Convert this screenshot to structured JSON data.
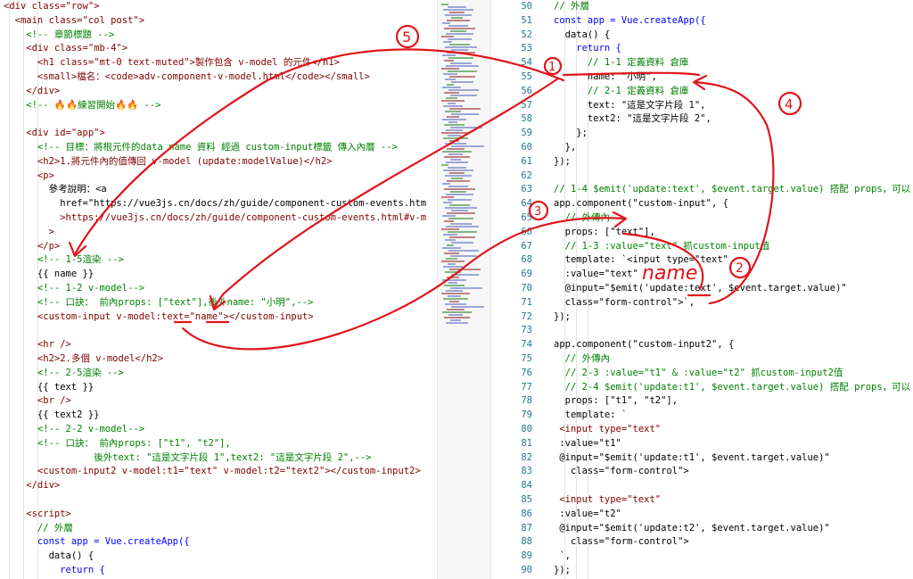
{
  "colors": {
    "tag": "#800000",
    "attr": "#e50000",
    "value": "#0000ff",
    "comment": "#008000",
    "keyword": "#0000ff",
    "text": "#000000",
    "string": "#a31515",
    "line_number": "#237893",
    "annotation": "#e0141b"
  },
  "left_pane": {
    "lines": [
      "<div class=\"row\">",
      "  <main class=\"col post\">",
      "    <!-- 章節標題 -->",
      "    <div class=\"mb-4\">",
      "      <h1 class=\"mt-0 text-muted\">製作包含 v-model 的元件</h1>",
      "      <small>檔名：<code>adv-component-v-model.html</code></small>",
      "    </div>",
      "    <!-- 🔥🔥練習開始🔥🔥 -->",
      "",
      "    <div id=\"app\">",
      "      <!-- 目標：將根元件的data name 資料 經過 custom-input標籤 傳入內層 -->",
      "      <h2>1.將元件內的值傳回 v-model (update:modelValue)</h2>",
      "      <p>",
      "        參考說明：<a",
      "          href=\"https://vue3js.cn/docs/zh/guide/component-custom-events.htm",
      "          >https://vue3js.cn/docs/zh/guide/component-custom-events.html#v-m",
      "        >",
      "      </p>",
      "      <!-- 1-5渲染 -->",
      "      {{ name }}",
      "      <!-- 1-2 v-model-->",
      "      <!-- 口訣： 前內props: [\"text\"],後外name: \"小明\",-->",
      "      <custom-input v-model:text=\"name\"></custom-input>",
      "",
      "      <hr />",
      "      <h2>2.多個 v-model</h2>",
      "      <!-- 2-5渲染 -->",
      "      {{ text }}",
      "      <br />",
      "      {{ text2 }}",
      "      <!-- 2-2 v-model-->",
      "      <!-- 口訣： 前內props: [\"t1\", \"t2\"],",
      "                後外text: \"這是文字片段 1\",text2: \"這是文字片段 2\",-->",
      "      <custom-input2 v-model:t1=\"text\" v-model:t2=\"text2\"></custom-input2>",
      "    </div>",
      "",
      "    <script>",
      "      // 外層",
      "      const app = Vue.createApp({",
      "        data() {",
      "          return {"
    ]
  },
  "right_pane": {
    "lines": [
      {
        "num": "50",
        "text": "// 外層"
      },
      {
        "num": "51",
        "text": "const app = Vue.createApp({"
      },
      {
        "num": "52",
        "text": "  data() {"
      },
      {
        "num": "53",
        "text": "    return {"
      },
      {
        "num": "54",
        "text": "      // 1-1 定義資料 倉庫"
      },
      {
        "num": "55",
        "text": "      name: \"小明\","
      },
      {
        "num": "56",
        "text": "      // 2-1 定義資料 倉庫"
      },
      {
        "num": "57",
        "text": "      text: \"這是文字片段 1\","
      },
      {
        "num": "58",
        "text": "      text2: \"這是文字片段 2\","
      },
      {
        "num": "59",
        "text": "    };"
      },
      {
        "num": "60",
        "text": "  },"
      },
      {
        "num": "61",
        "text": "});"
      },
      {
        "num": "62",
        "text": ""
      },
      {
        "num": "63",
        "text": "// 1-4 $emit('update:text', $event.target.value) 搭配 props，可以"
      },
      {
        "num": "64",
        "text": "app.component(\"custom-input\", {"
      },
      {
        "num": "65",
        "text": "  // 外傳內"
      },
      {
        "num": "66",
        "text": "  props: [\"text\"],"
      },
      {
        "num": "67",
        "text": "  // 1-3 :value=\"text\" 抓custom-input值"
      },
      {
        "num": "68",
        "text": "  template: `<input type=\"text\""
      },
      {
        "num": "69",
        "text": "  :value=\"text\""
      },
      {
        "num": "70",
        "text": "  @input=\"$emit('update:text', $event.target.value)\""
      },
      {
        "num": "71",
        "text": "  class=\"form-control\">`,"
      },
      {
        "num": "72",
        "text": "});"
      },
      {
        "num": "73",
        "text": ""
      },
      {
        "num": "74",
        "text": "app.component(\"custom-input2\", {"
      },
      {
        "num": "75",
        "text": "  // 外傳內"
      },
      {
        "num": "76",
        "text": "  // 2-3 :value=\"t1\" & :value=\"t2\" 抓custom-input2值"
      },
      {
        "num": "77",
        "text": "  // 2-4 $emit('update:t1', $event.target.value) 搭配 props，可以"
      },
      {
        "num": "78",
        "text": "  props: [\"t1\", \"t2\"],"
      },
      {
        "num": "79",
        "text": "  template: `"
      },
      {
        "num": "80",
        "text": " <input type=\"text\""
      },
      {
        "num": "81",
        "text": " :value=\"t1\""
      },
      {
        "num": "82",
        "text": " @input=\"$emit('update:t1', $event.target.value)\""
      },
      {
        "num": "83",
        "text": "   class=\"form-control\">"
      },
      {
        "num": "84",
        "text": ""
      },
      {
        "num": "85",
        "text": " <input type=\"text\""
      },
      {
        "num": "86",
        "text": " :value=\"t2\""
      },
      {
        "num": "87",
        "text": " @input=\"$emit('update:t2', $event.target.value)\""
      },
      {
        "num": "88",
        "text": "   class=\"form-control\">"
      },
      {
        "num": "89",
        "text": " `,"
      },
      {
        "num": "90",
        "text": "});"
      }
    ]
  },
  "annotations": {
    "labels": [
      "5",
      "1",
      "4",
      "3",
      "2"
    ],
    "handwritten_name": "name"
  }
}
